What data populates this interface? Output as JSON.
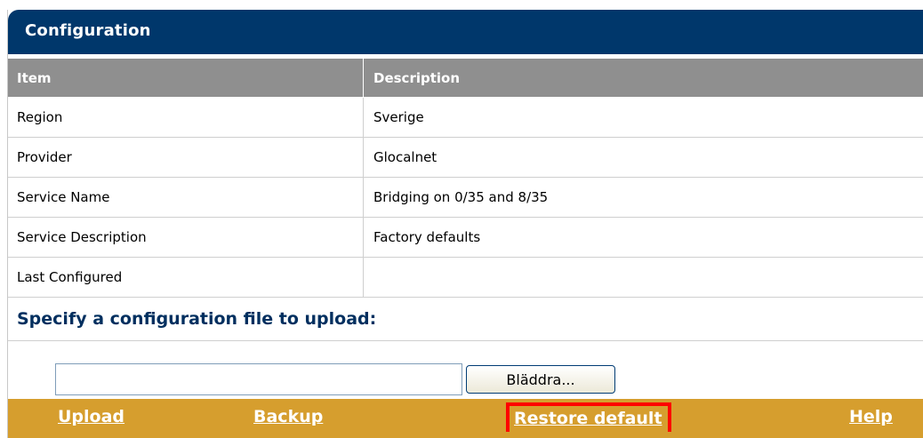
{
  "panel": {
    "title": "Configuration"
  },
  "table": {
    "headers": {
      "item": "Item",
      "description": "Description"
    },
    "rows": [
      {
        "item": "Region",
        "description": "Sverige"
      },
      {
        "item": "Provider",
        "description": "Glocalnet"
      },
      {
        "item": "Service Name",
        "description": "Bridging on 0/35 and 8/35"
      },
      {
        "item": "Service Description",
        "description": "Factory defaults"
      },
      {
        "item": "Last Configured",
        "description": ""
      }
    ]
  },
  "upload": {
    "heading": "Specify a configuration file to upload:",
    "file_value": "",
    "browse_label": "Bläddra..."
  },
  "actions": {
    "upload": "Upload",
    "backup": "Backup",
    "restore": "Restore default",
    "help": "Help"
  },
  "colors": {
    "title_bar": "#00376b",
    "header_row": "#8f8f8f",
    "action_bar": "#d69e2e",
    "highlight": "#ff0000"
  }
}
